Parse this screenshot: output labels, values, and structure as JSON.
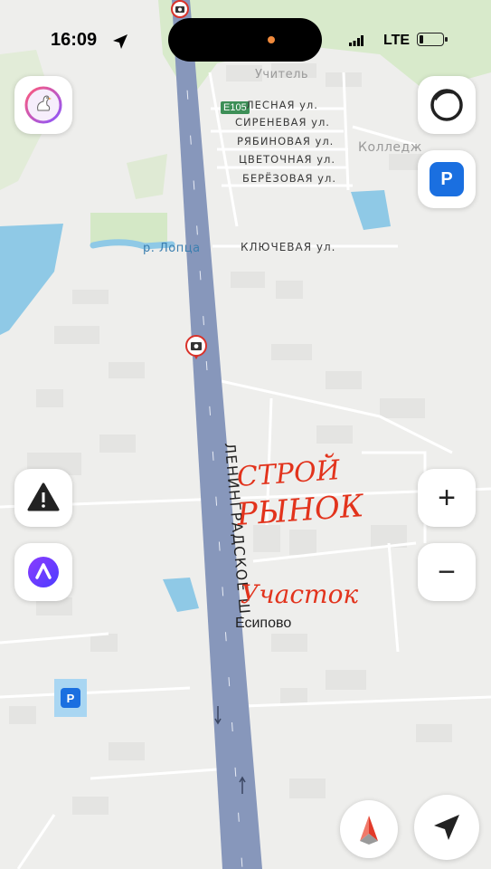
{
  "status_bar": {
    "time": "16:09",
    "network": "LTE",
    "battery_level": 0.15
  },
  "map": {
    "route_shield": "E105",
    "highway_name": "ЛЕНИНГРАДСКОЕ Ш.",
    "streets": [
      "ЛЕСНАЯ ул.",
      "СИРЕНЕВАЯ ул.",
      "РЯБИНОВАЯ ул.",
      "ЦВЕТОЧНАЯ ул.",
      "БЕРЁЗОВАЯ ул.",
      "КЛЮЧЕВАЯ ул."
    ],
    "river": "р. Лопца",
    "village": "Есипово",
    "faded_labels": {
      "teacher": "Учитель",
      "college": "Колледж"
    },
    "handwritten": {
      "line1": "СТРОЙ",
      "line2": "РЫНОК",
      "line3": "Участок"
    },
    "colors": {
      "highway": "#8797bb",
      "water": "#8fc9e6",
      "annotation": "#e2331c",
      "parking": "#1a6fe0",
      "alice": "#6b3cff"
    }
  },
  "controls": {
    "app_icon": "goose-icon",
    "layers": "layers-icon",
    "parking_label": "P",
    "parking_marker_label": "P",
    "alert": "warning-icon",
    "assistant": "alice-icon",
    "zoom_in_label": "+",
    "zoom_out_label": "−",
    "compass": "compass-icon",
    "locate": "locate-icon"
  }
}
